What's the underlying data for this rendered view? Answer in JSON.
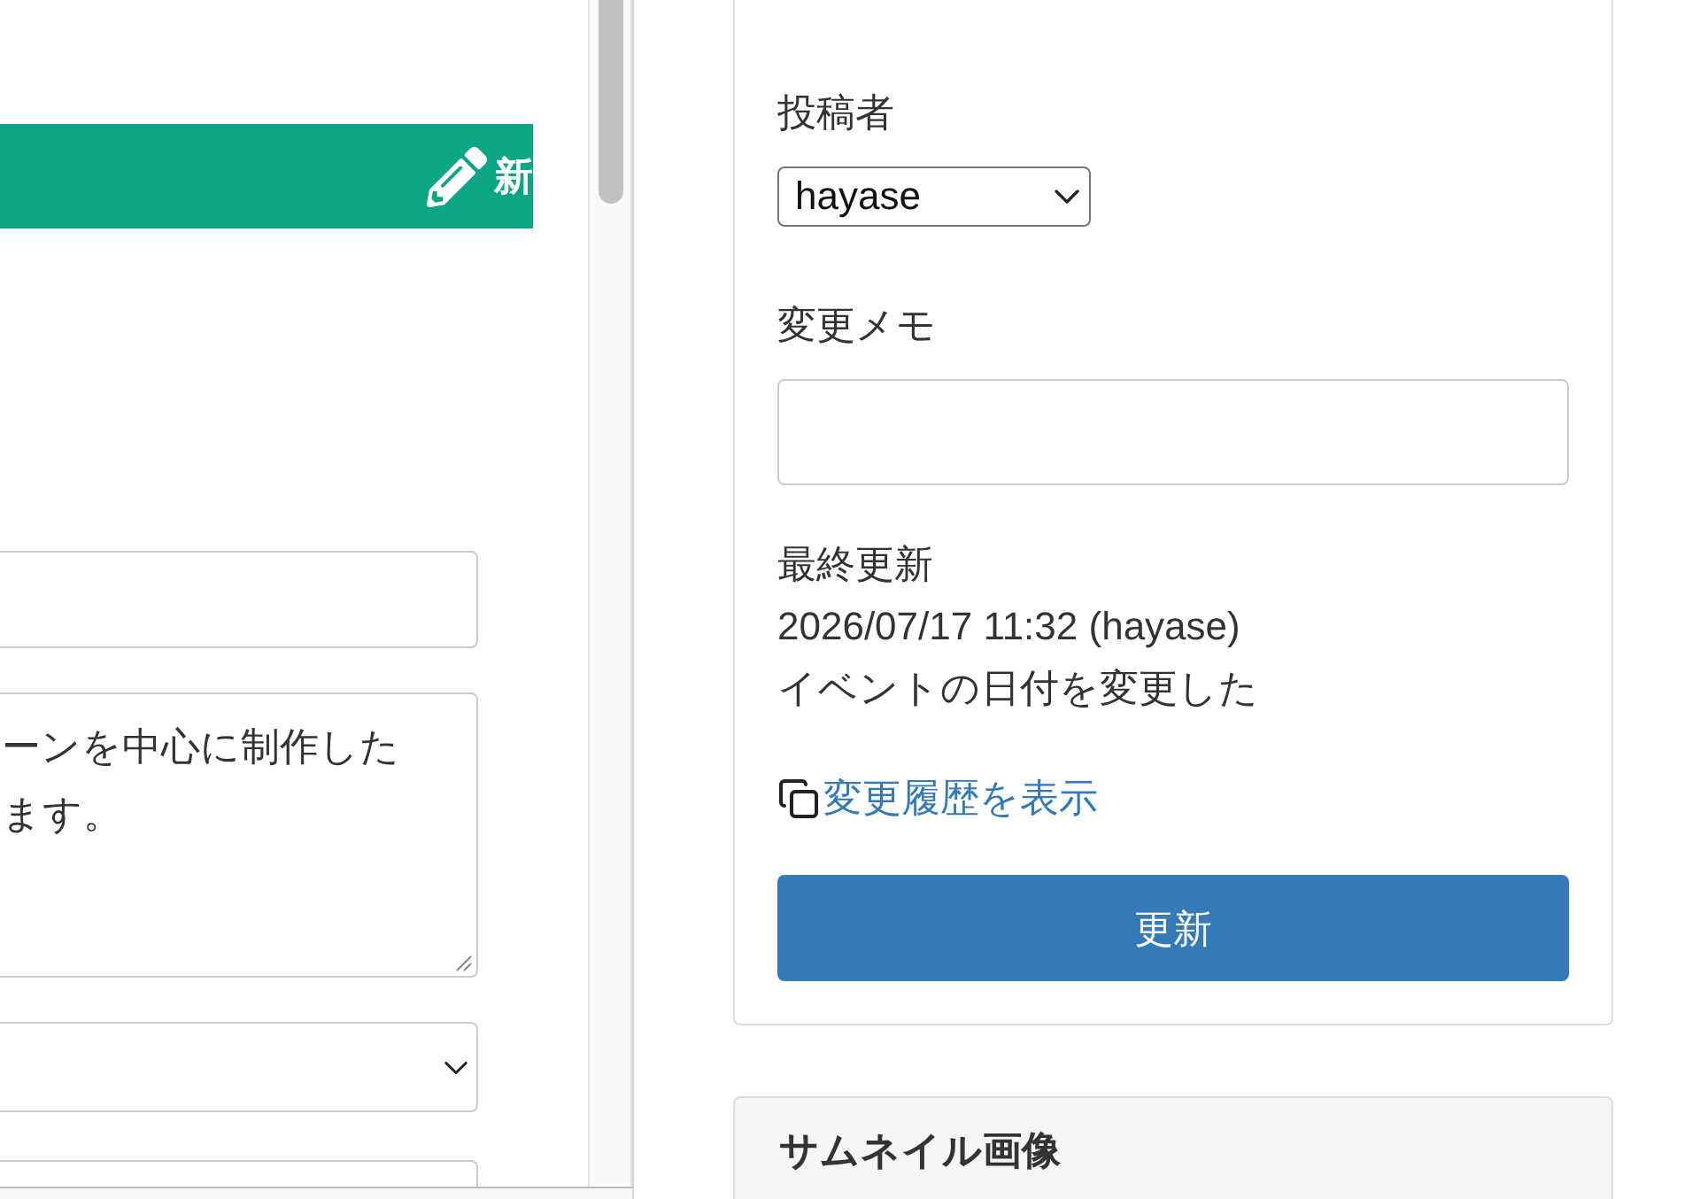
{
  "editor_frame": {
    "banner": {
      "label": "新"
    },
    "fields": [
      {
        "kind": "text"
      },
      {
        "kind": "textarea",
        "lines": [
          "ーンを中心に制作した",
          "ます。"
        ]
      },
      {
        "kind": "select"
      },
      {
        "kind": "text"
      }
    ]
  },
  "publish_panel": {
    "author": {
      "label": "投稿者",
      "value": "hayase"
    },
    "change_memo": {
      "label": "変更メモ"
    },
    "last_updated": {
      "label": "最終更新",
      "timestamp": "2026/07/17 11:32 (hayase)",
      "note": "イベントの日付を変更した"
    },
    "history_link": "変更履歴を表示",
    "update_button": "更新"
  },
  "thumbnail_panel": {
    "title": "サムネイル画像"
  }
}
